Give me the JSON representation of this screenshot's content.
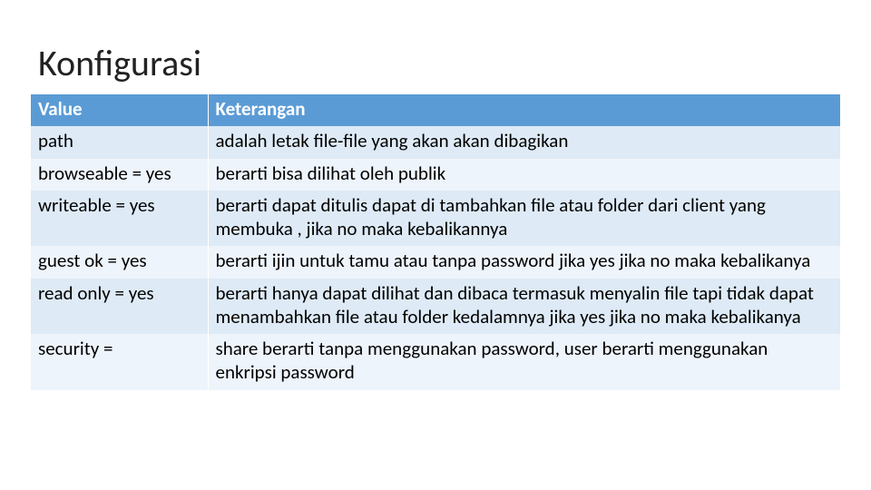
{
  "title": "Konfigurasi",
  "table": {
    "headers": [
      "Value",
      "Keterangan"
    ],
    "rows": [
      {
        "value": "path",
        "desc": "adalah letak file-file yang akan akan dibagikan"
      },
      {
        "value": "browseable = yes",
        "desc": "berarti bisa dilihat oleh publik"
      },
      {
        "value": "writeable = yes",
        "desc": "berarti dapat ditulis dapat di tambahkan file atau folder dari client yang membuka , jika no maka kebalikannya"
      },
      {
        "value": "guest ok = yes",
        "desc": "berarti ijin untuk tamu atau tanpa password jika yes jika no maka kebalikanya"
      },
      {
        "value": "read only = yes",
        "desc": "berarti hanya dapat dilihat dan dibaca termasuk menyalin file tapi tidak dapat menambahkan file atau folder kedalamnya jika yes jika no maka kebalikanya"
      },
      {
        "value": "security =",
        "desc": "share berarti tanpa menggunakan password, user berarti menggunakan enkripsi password"
      }
    ]
  }
}
